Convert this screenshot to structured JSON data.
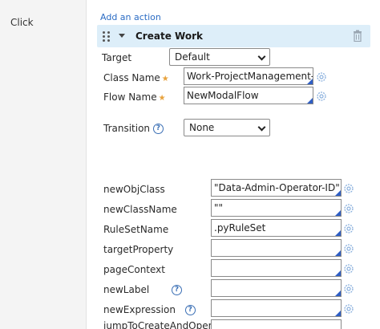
{
  "left": {
    "event_label": "Click"
  },
  "action": {
    "add_label": "Add an action",
    "title": "Create Work"
  },
  "form": {
    "target": {
      "label": "Target",
      "value": "Default"
    },
    "class_name": {
      "label": "Class Name",
      "value": "Work-ProjectManagement-Ne"
    },
    "flow_name": {
      "label": "Flow Name",
      "value": "NewModalFlow"
    },
    "transition": {
      "label": "Transition",
      "value": "None"
    }
  },
  "params": [
    {
      "label": "newObjClass",
      "value": "\"Data-Admin-Operator-ID\""
    },
    {
      "label": "newClassName",
      "value": "\"\""
    },
    {
      "label": "RuleSetName",
      "value": ".pyRuleSet"
    },
    {
      "label": "targetProperty",
      "value": ""
    },
    {
      "label": "pageContext",
      "value": ""
    },
    {
      "label": "newLabel",
      "value": ""
    },
    {
      "label": "newExpression",
      "value": ""
    },
    {
      "label": "jumpToCreateAndOpen",
      "value": ""
    }
  ],
  "icons": {
    "drag": "drag-handle-icon",
    "collapse": "chevron-down-icon",
    "delete": "trash-icon",
    "param": "gear-icon",
    "help": "help-icon"
  },
  "help_glyph": "?",
  "required_glyph": "★",
  "colors": {
    "accent": "#2b6cc4",
    "header_bg": "#ddeef9",
    "required": "#e8a23c"
  }
}
